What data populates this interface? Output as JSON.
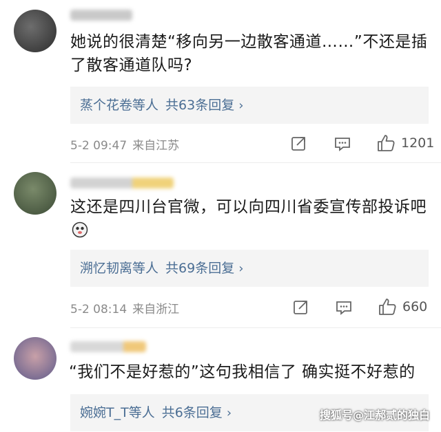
{
  "comments": [
    {
      "username": "",
      "text": "她说的很清楚“移向另一边散客通道……”不还是插了散客通道队吗?",
      "reply_users": "蒸个花卷等人",
      "reply_count": "共63条回复",
      "date": "5-2 09:47",
      "location": "来自江苏",
      "likes": "1201"
    },
    {
      "username": "",
      "text": "这还是四川台官微，可以向四川省委宣传部投诉吧",
      "reply_users": "溯忆韧离等人",
      "reply_count": "共69条回复",
      "date": "5-2 08:14",
      "location": "来自浙江",
      "likes": "660"
    },
    {
      "username": "",
      "text": "“我们不是好惹的”这句我相信了 确实挺不好惹的",
      "reply_users": "婉婉T_T等人",
      "reply_count": "共6条回复"
    }
  ],
  "watermark": "搜狐号@江郝贰的独白",
  "icons": [
    "share-icon",
    "comment-icon",
    "like-icon",
    "chevron-right-icon"
  ]
}
